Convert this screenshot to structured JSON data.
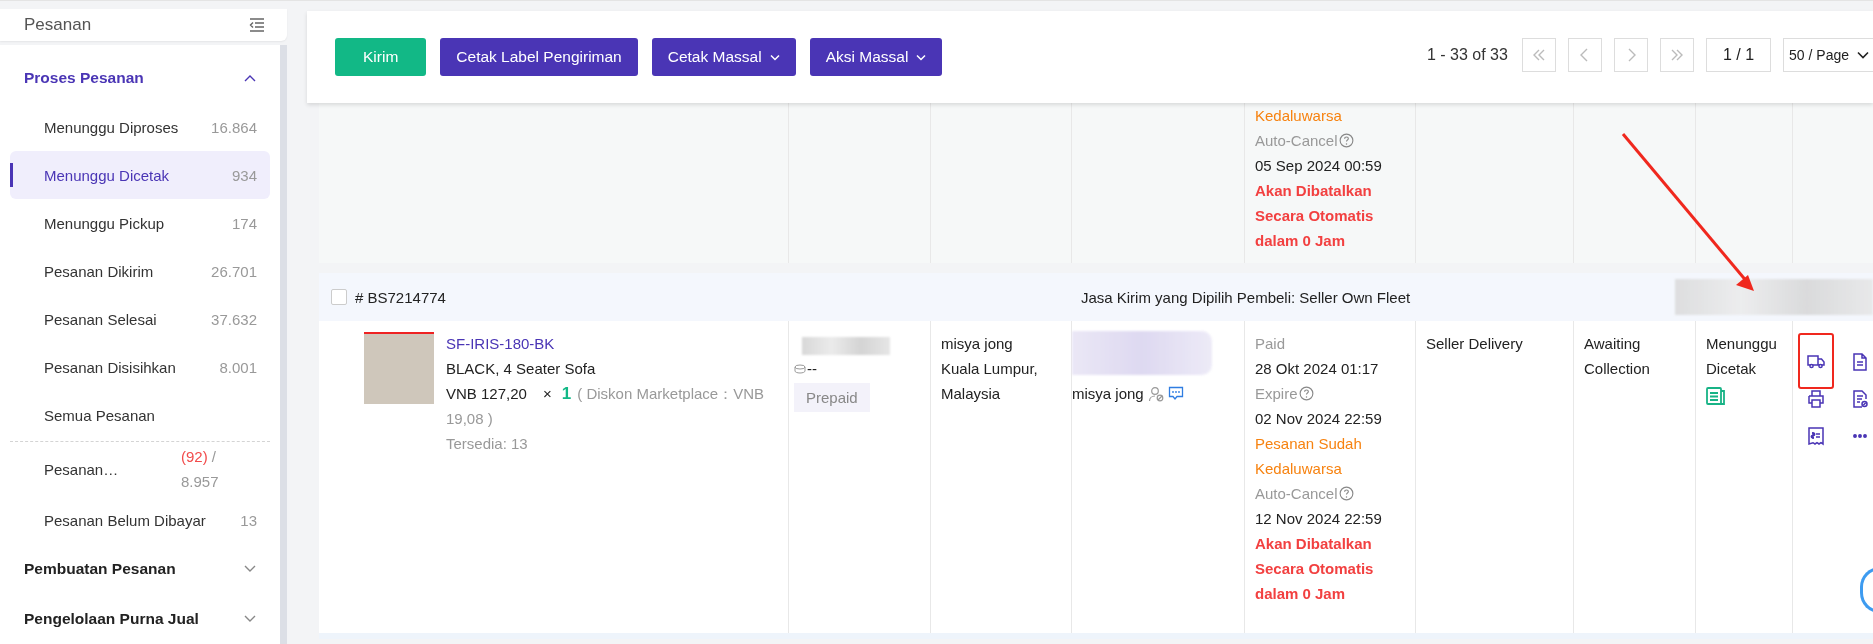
{
  "sidebar": {
    "title": "Pesanan",
    "sections": [
      {
        "label": "Proses Pesanan",
        "expanded": true,
        "active": true,
        "items": [
          {
            "label": "Menunggu Diproses",
            "count": "16.864",
            "selected": false
          },
          {
            "label": "Menunggu Dicetak",
            "count": "934",
            "selected": true
          },
          {
            "label": "Menunggu Pickup",
            "count": "174",
            "selected": false
          },
          {
            "label": "Pesanan Dikirim",
            "count": "26.701",
            "selected": false
          },
          {
            "label": "Pesanan Selesai",
            "count": "37.632",
            "selected": false
          },
          {
            "label": "Pesanan Disisihkan",
            "count": "8.001",
            "selected": false
          },
          {
            "label": "Semua Pesanan",
            "selected": false
          }
        ],
        "more_items": [
          {
            "label": "Pesanan…",
            "alert_count": "(92)",
            "count": "/ 8.957",
            "selected": false
          },
          {
            "label": "Pesanan Belum Dibayar",
            "count": "13",
            "selected": false
          }
        ]
      },
      {
        "label": "Pembuatan Pesanan",
        "expanded": false,
        "active": false
      },
      {
        "label": "Pengelolaan Purna Jual",
        "expanded": false,
        "active": false
      }
    ]
  },
  "toolbar": {
    "buttons": [
      {
        "label": "Kirim",
        "kind": "primary",
        "dropdown": false
      },
      {
        "label": "Cetak Label Pengiriman",
        "kind": "secondary",
        "dropdown": false
      },
      {
        "label": "Cetak Massal",
        "kind": "secondary",
        "dropdown": true
      },
      {
        "label": "Aksi Massal",
        "kind": "secondary",
        "dropdown": true
      }
    ],
    "pagination": {
      "range": "1 - 33 of 33",
      "nav": [
        {
          "kind": "first",
          "disabled": true
        },
        {
          "kind": "prev",
          "disabled": true
        },
        {
          "kind": "next",
          "disabled": true
        },
        {
          "kind": "last",
          "disabled": true
        }
      ],
      "page": "1 / 1",
      "page_size": "50 / Page"
    }
  },
  "previous_order": {
    "time_lines": [
      {
        "text": "Kedaluwarsa",
        "kind": "warning",
        "help": false
      },
      {
        "text": "Auto-Cancel",
        "kind": "muted",
        "help": true
      },
      {
        "text": "05 Sep 2024 00:59",
        "kind": "normal",
        "help": false
      },
      {
        "text": "Akan Dibatalkan Secara Otomatis dalam 0 Jam",
        "kind": "danger",
        "help": false
      }
    ]
  },
  "order": {
    "id": "# BS7214774",
    "checked": false,
    "shipping_note": "Jasa Kirim yang Dipilih Pembeli: Seller Own Fleet",
    "product": {
      "sku": "SF-IRIS-180-BK",
      "name": "BLACK, 4 Seater Sofa",
      "price": "VNB 127,20",
      "times": "×",
      "quantity": "1",
      "discount": "( Diskon Marketplace：VNB 19,08 )",
      "stock": "Tersedia: 13"
    },
    "payment": {
      "amount": "--",
      "tag": "Prepaid"
    },
    "address": [
      "misya jong",
      "Kuala Lumpur,",
      "Malaysia"
    ],
    "buyer": "misya jong",
    "time_lines": [
      {
        "text": "Paid",
        "kind": "muted",
        "help": false
      },
      {
        "text": "28 Okt 2024 01:17",
        "kind": "normal",
        "help": false
      },
      {
        "text": "Expire",
        "kind": "muted",
        "help": true
      },
      {
        "text": "02 Nov 2024 22:59",
        "kind": "normal",
        "help": false
      },
      {
        "text": "Pesanan Sudah Kedaluwarsa",
        "kind": "warning",
        "help": false
      },
      {
        "text": "Auto-Cancel",
        "kind": "muted",
        "help": true
      },
      {
        "text": "12 Nov 2024 22:59",
        "kind": "normal",
        "help": false
      },
      {
        "text": "Akan Dibatalkan Secara Otomatis dalam 0 Jam",
        "kind": "danger",
        "help": false
      }
    ],
    "shipping": "Seller Delivery",
    "shipping_status": "Awaiting Collection",
    "order_status": "Menunggu Dicetak",
    "actions": [
      {
        "kind": "ship",
        "highlighted": true
      },
      {
        "kind": "document",
        "highlighted": false
      },
      {
        "kind": "print",
        "highlighted": false
      },
      {
        "kind": "edit",
        "highlighted": false
      },
      {
        "kind": "receipt",
        "highlighted": false
      },
      {
        "kind": "more",
        "highlighted": false
      }
    ]
  }
}
